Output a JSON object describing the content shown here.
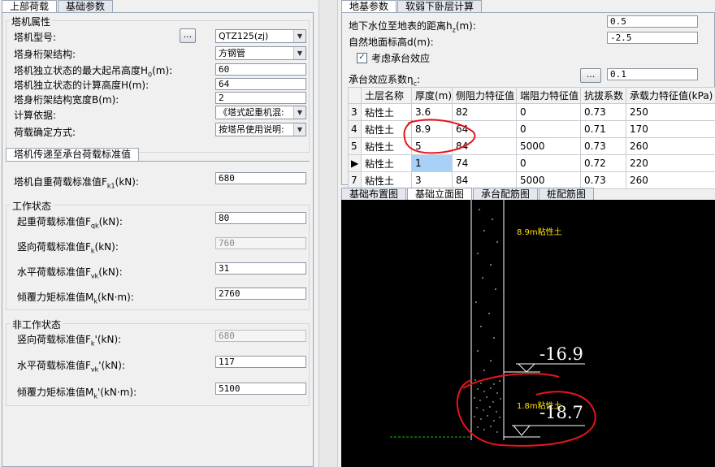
{
  "left_tabs": [
    "上部荷载",
    "基础参数"
  ],
  "tower_props": {
    "title": "塔机属性",
    "model_label": "塔机型号:",
    "model_button": "...",
    "model_value": "QTZ125(zj)",
    "structure_label": "塔身桁架结构:",
    "structure_value": "方钢管",
    "max_height_label": "塔机独立状态的最大起吊高度H",
    "max_height_sub": "0",
    "max_height_unit": "(m):",
    "max_height_value": "60",
    "calc_height_label": "塔机独立状态的计算高度H(m):",
    "calc_height_value": "64",
    "width_label": "塔身桁架结构宽度B(m):",
    "width_value": "2",
    "basis_label": "计算依据:",
    "basis_value": "《塔式起重机混:",
    "load_method_label": "荷载确定方式:",
    "load_method_value": "按塔吊使用说明:"
  },
  "std_tab": "塔机传递至承台荷载标准值",
  "self_weight": {
    "label": "塔机自重荷载标准值F",
    "sub": "k1",
    "unit": "(kN):",
    "value": "680"
  },
  "working": {
    "title": "工作状态",
    "lift_label": "起重荷载标准值F",
    "lift_sub": "qk",
    "lift_unit": "(kN):",
    "lift_value": "80",
    "vertical_label": "竖向荷载标准值F",
    "vertical_sub": "k",
    "vertical_unit": "(kN):",
    "vertical_value": "760",
    "horizontal_label": "水平荷载标准值F",
    "horizontal_sub": "vk",
    "horizontal_unit": "(kN):",
    "horizontal_value": "31",
    "moment_label": "倾覆力矩标准值M",
    "moment_sub": "k",
    "moment_unit": "(kN·m):",
    "moment_value": "2760"
  },
  "non_working": {
    "title": "非工作状态",
    "vertical_label": "竖向荷载标准值F",
    "vertical_sub": "k",
    "vertical_unit": "'(kN):",
    "vertical_value": "680",
    "horizontal_label": "水平荷载标准值F",
    "horizontal_sub": "vk",
    "horizontal_unit": "'(kN):",
    "horizontal_value": "117",
    "moment_label": "倾覆力矩标准值M",
    "moment_sub": "k",
    "moment_unit": "'(kN·m):",
    "moment_value": "5100"
  },
  "right_tabs": [
    "地基参数",
    "软弱下卧层计算"
  ],
  "ground": {
    "water_label": "地下水位至地表的距离h",
    "water_sub": "z",
    "water_unit": "(m):",
    "water_value": "0.5",
    "elev_label": "自然地面标高d(m):",
    "elev_value": "-2.5",
    "cap_effect_label": "考虑承台效应",
    "cap_effect_check": "✓",
    "cap_coef_label": "承台效应系数η",
    "cap_coef_sub": "c",
    "cap_coef_unit": ":",
    "cap_coef_button": "...",
    "cap_coef_value": "0.1"
  },
  "soil_table": {
    "headers": [
      "土层名称",
      "厚度(m)",
      "侧阻力特征值",
      "端阻力特征值",
      "抗拔系数",
      "承载力特征值(kPa)"
    ],
    "rows": [
      {
        "no": "3",
        "cells": [
          "粘性土",
          "3.6",
          "82",
          "0",
          "0.73",
          "250"
        ]
      },
      {
        "no": "4",
        "cells": [
          "粘性土",
          "8.9",
          "64",
          "0",
          "0.71",
          "170"
        ]
      },
      {
        "no": "5",
        "cells": [
          "粘性土",
          "5",
          "84",
          "5000",
          "0.73",
          "260"
        ]
      },
      {
        "no": "▶",
        "cells": [
          "粘性土",
          "1",
          "74",
          "0",
          "0.72",
          "220"
        ]
      },
      {
        "no": "7",
        "cells": [
          "粘性土",
          "3",
          "84",
          "5000",
          "0.73",
          "260"
        ]
      }
    ]
  },
  "view_tabs": [
    "基础布置图",
    "基础立面图",
    "承台配筋图",
    "桩配筋图"
  ],
  "drawing": {
    "layer_upper_label": "8.9m粘性土",
    "layer_lower_label": "1.8m粘性土",
    "level_upper": "-16.9",
    "level_lower": "-18.7"
  },
  "colors": {
    "annotation_red": "#e8141c",
    "label_yellow": "#ffe000",
    "dashed_green": "#22b422",
    "selected_cell": "#a9d1f7"
  }
}
